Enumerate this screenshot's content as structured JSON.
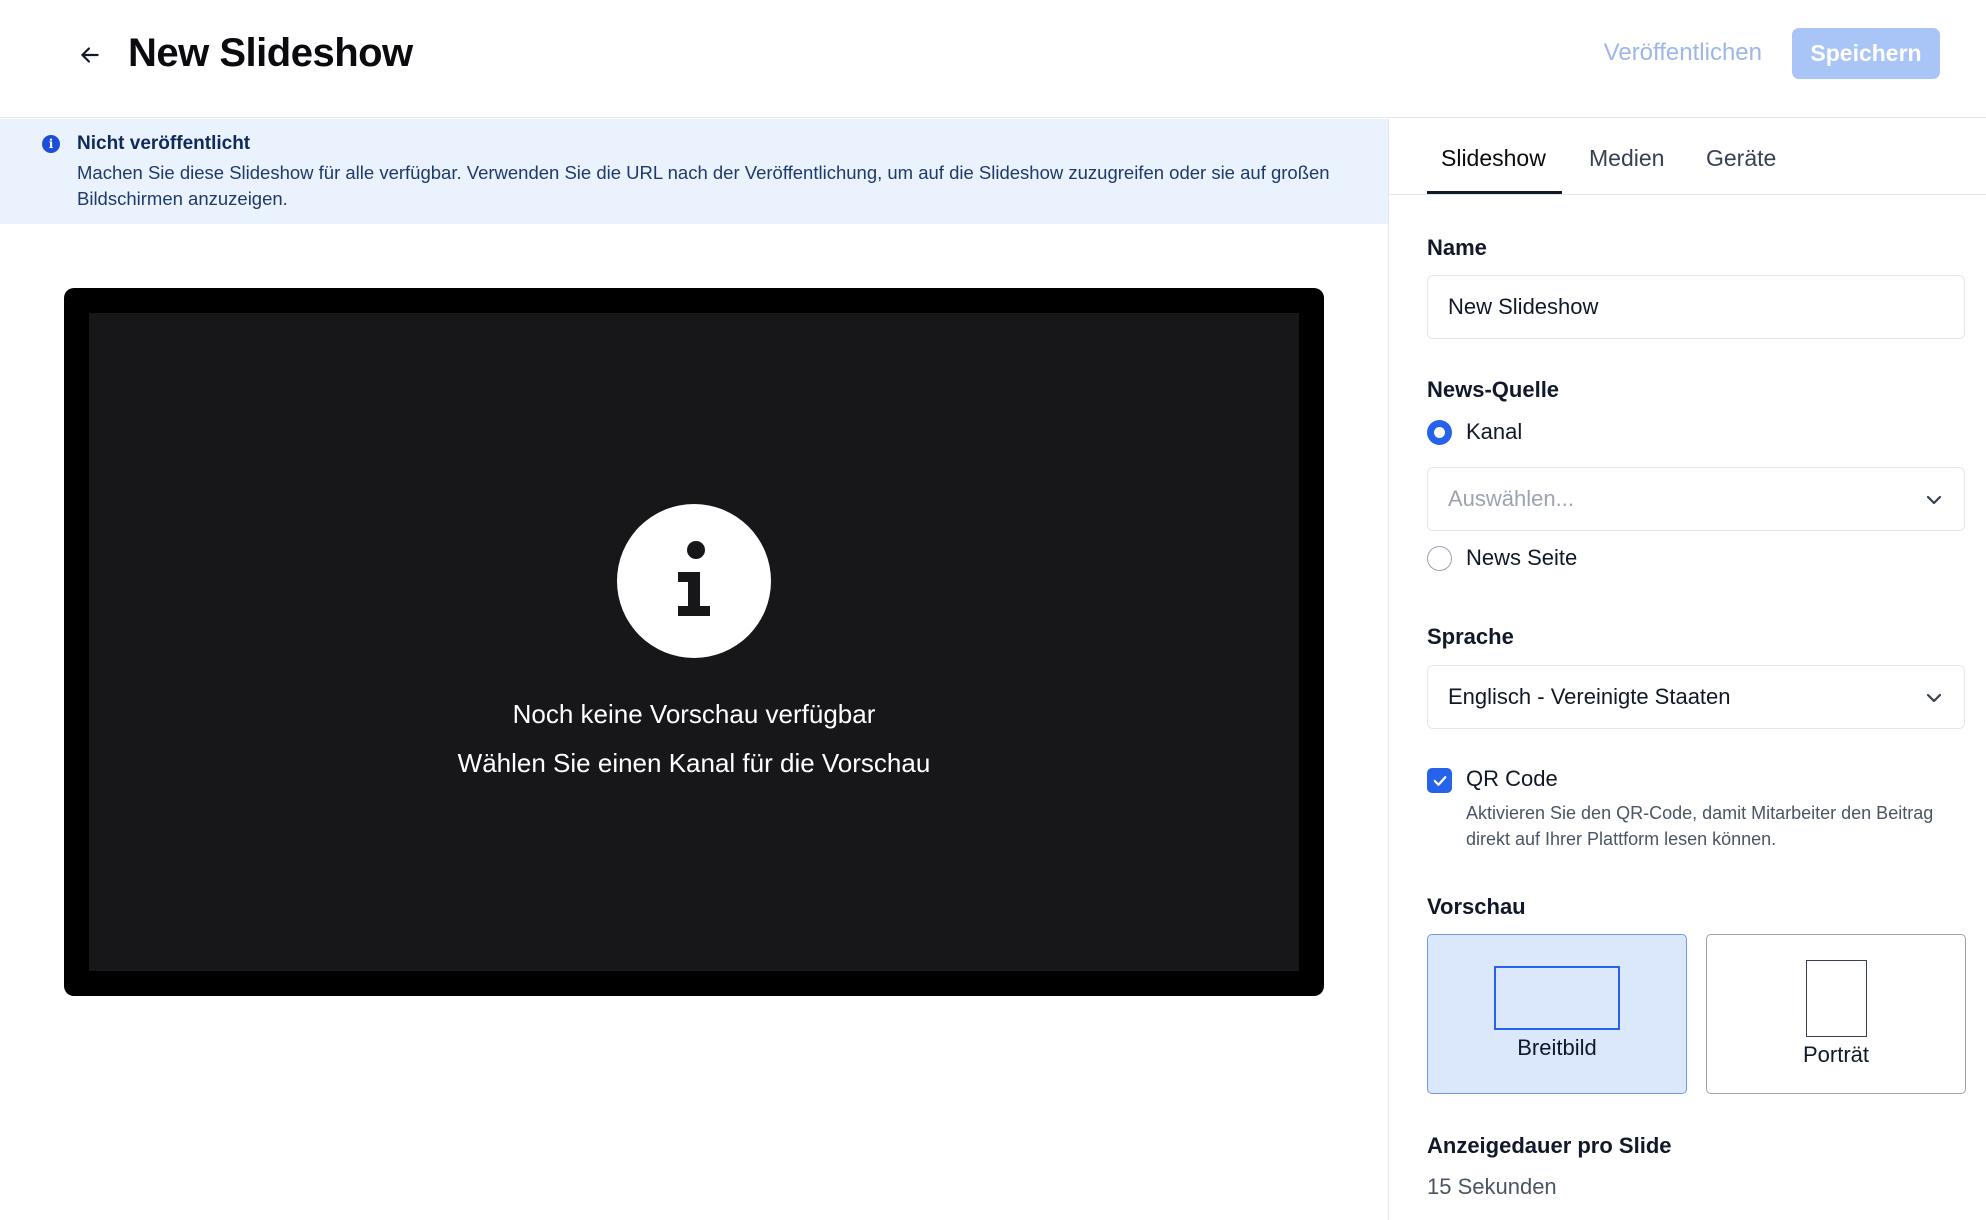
{
  "header": {
    "title": "New Slideshow",
    "publish_label": "Veröffentlichen",
    "save_label": "Speichern"
  },
  "notice": {
    "title": "Nicht veröffentlicht",
    "body": "Machen Sie diese Slideshow für alle verfügbar. Verwenden Sie die URL nach der Veröffentlichung, um auf die Slideshow zuzugreifen oder sie auf großen Bildschirmen anzuzeigen."
  },
  "preview": {
    "line1": "Noch keine Vorschau verfügbar",
    "line2": "Wählen Sie einen Kanal für die Vorschau"
  },
  "tabs": [
    {
      "label": "Slideshow",
      "active": true
    },
    {
      "label": "Medien",
      "active": false
    },
    {
      "label": "Geräte",
      "active": false
    }
  ],
  "form": {
    "name_label": "Name",
    "name_value": "New Slideshow",
    "source_label": "News-Quelle",
    "source_option_channel": "Kanal",
    "channel_placeholder": "Auswählen...",
    "source_option_page": "News Seite",
    "language_label": "Sprache",
    "language_value": "Englisch - Vereinigte Staaten",
    "qr_label": "QR Code",
    "qr_checked": true,
    "qr_help": "Aktivieren Sie den QR-Code, damit Mitarbeiter den Beitrag direkt auf Ihrer Plattform lesen können.",
    "preview_label": "Vorschau",
    "layout_options": [
      {
        "label": "Breitbild",
        "selected": true
      },
      {
        "label": "Porträt",
        "selected": false
      }
    ],
    "duration_label": "Anzeigedauer pro Slide",
    "duration_value": "15 Sekunden"
  },
  "colors": {
    "accent": "#2563eb",
    "save_button_disabled": "#a9c5f7",
    "notice_bg": "#eaf2fd"
  }
}
